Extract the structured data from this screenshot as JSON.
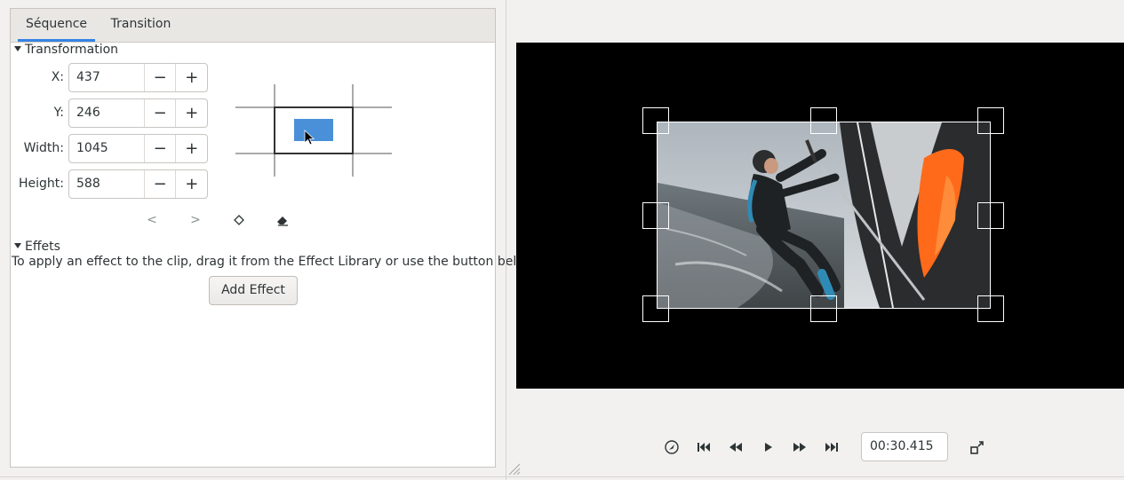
{
  "tabs": [
    {
      "label": "Séquence",
      "active": true
    },
    {
      "label": "Transition",
      "active": false
    }
  ],
  "transformation": {
    "header": "Transformation",
    "fields": [
      {
        "label": "X:",
        "value": "437"
      },
      {
        "label": "Y:",
        "value": "246"
      },
      {
        "label": "Width:",
        "value": "1045"
      },
      {
        "label": "Height:",
        "value": "588"
      }
    ],
    "minus_glyph": "−",
    "plus_glyph": "+",
    "keyframe_prev": "<",
    "keyframe_next": ">",
    "keyframe_add_icon": "diamond-icon",
    "keyframe_remove_icon": "eraser-icon"
  },
  "effects": {
    "header": "Effets",
    "hint": "To apply an effect to the clip, drag it from the Effect Library or use the button below.",
    "add_button": "Add Effect"
  },
  "transport": {
    "icons": [
      "snap-icon",
      "skip-to-start-icon",
      "rewind-icon",
      "play-icon",
      "fast-forward-icon",
      "skip-to-end-icon",
      "fullscreen-icon"
    ],
    "timecode": "00:30.415"
  },
  "colors": {
    "accent": "#3584e4",
    "preview_rect": "#4a90d9"
  }
}
